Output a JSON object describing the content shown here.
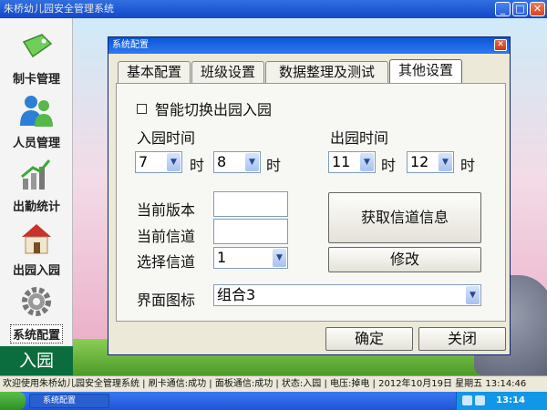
{
  "app": {
    "title": "朱桥幼儿园安全管理系统"
  },
  "nav": {
    "items": [
      {
        "label": "制卡管理",
        "icon": "card-tag-icon"
      },
      {
        "label": "人员管理",
        "icon": "people-icon"
      },
      {
        "label": "出勤统计",
        "icon": "bar-chart-icon"
      },
      {
        "label": "出园入园",
        "icon": "house-icon"
      },
      {
        "label": "系统配置",
        "icon": "gear-icon"
      }
    ],
    "mode_label": "入园"
  },
  "dialog": {
    "title": "系统配置",
    "tabs": [
      "基本配置",
      "班级设置",
      "数据整理及测试",
      "其他设置"
    ],
    "active_tab": "其他设置",
    "smart_switch_label": "智能切换出园入园",
    "entry_time_label": "入园时间",
    "exit_time_label": "出园时间",
    "hour_suffix": "时",
    "entry_from": "7",
    "entry_to": "8",
    "exit_from": "11",
    "exit_to": "12",
    "version_label": "当前版本",
    "channel_label": "当前信道",
    "select_channel_label": "选择信道",
    "select_channel_value": "1",
    "get_channel_button": "获取信道信息",
    "modify_button": "修改",
    "ui_icon_label": "界面图标",
    "ui_icon_value": "组合3",
    "ok_button": "确定",
    "close_button": "关闭"
  },
  "status_bar": {
    "text": "欢迎使用朱桥幼儿园安全管理系统 | 刷卡通信:成功 | 面板通信:成功 | 状态:入园 | 电压:掉电 | 2012年10月19日 星期五 13:14:46"
  },
  "taskbar": {
    "app_button": "系统配置",
    "clock": "13:14"
  }
}
